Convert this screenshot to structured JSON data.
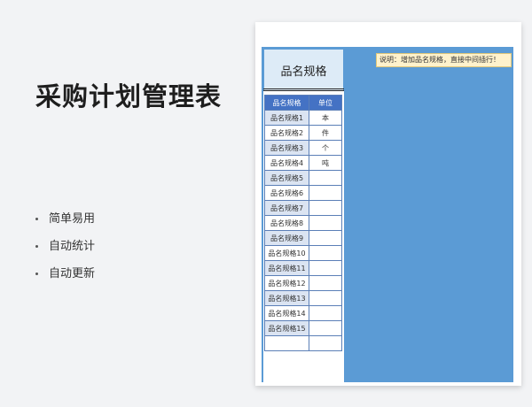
{
  "title": "采购计划管理表",
  "features": [
    "简单易用",
    "自动统计",
    "自动更新"
  ],
  "sheet": {
    "panel_title": "品名规格",
    "note": "说明：增加品名规格，直接中间插行！",
    "headers": [
      "品名规格",
      "单位"
    ],
    "rows": [
      {
        "name": "品名规格1",
        "unit": "本"
      },
      {
        "name": "品名规格2",
        "unit": "件"
      },
      {
        "name": "品名规格3",
        "unit": "个"
      },
      {
        "name": "品名规格4",
        "unit": "吨"
      },
      {
        "name": "品名规格5",
        "unit": ""
      },
      {
        "name": "品名规格6",
        "unit": ""
      },
      {
        "name": "品名规格7",
        "unit": ""
      },
      {
        "name": "品名规格8",
        "unit": ""
      },
      {
        "name": "品名规格9",
        "unit": ""
      },
      {
        "name": "品名规格10",
        "unit": ""
      },
      {
        "name": "品名规格11",
        "unit": ""
      },
      {
        "name": "品名规格12",
        "unit": ""
      },
      {
        "name": "品名规格13",
        "unit": ""
      },
      {
        "name": "品名规格14",
        "unit": ""
      },
      {
        "name": "品名规格15",
        "unit": ""
      },
      {
        "name": "",
        "unit": ""
      }
    ]
  },
  "colors": {
    "accent": "#5b9bd5",
    "header": "#4472c4",
    "note_bg": "#fff2cc"
  }
}
